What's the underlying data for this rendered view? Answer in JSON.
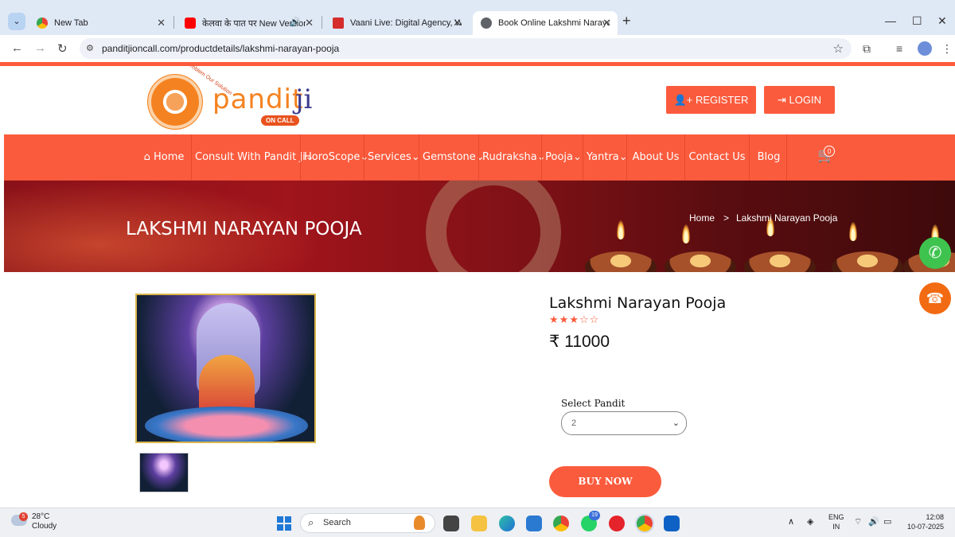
{
  "browser": {
    "tabs": [
      {
        "title": "New Tab"
      },
      {
        "title": "केलवा के पात पर New Version"
      },
      {
        "title": "Vaani Live: Digital Agency, Web"
      },
      {
        "title": "Book Online Lakshmi Narayan P"
      }
    ],
    "url": "panditjioncall.com/productdetails/lakshmi-narayan-pooja"
  },
  "site": {
    "logo": {
      "brand": "pandit",
      "brand_suffix": "ji",
      "oncall": "ON CALL",
      "tagline": "Your Problem Our Solution"
    },
    "register_label": "REGISTER",
    "login_label": "LOGIN",
    "nav": [
      {
        "label": "Home"
      },
      {
        "label": "Consult With Pandit Ji"
      },
      {
        "label": "HoroScope"
      },
      {
        "label": "Services"
      },
      {
        "label": "Gemstone"
      },
      {
        "label": "Rudraksha"
      },
      {
        "label": "Pooja"
      },
      {
        "label": "Yantra"
      },
      {
        "label": "About Us"
      },
      {
        "label": "Contact Us"
      },
      {
        "label": "Blog"
      }
    ],
    "cart_count": "0"
  },
  "hero": {
    "title": "LAKSHMI NARAYAN POOJA",
    "breadcrumb": {
      "home": "Home",
      "sep": ">",
      "current": "Lakshmi Narayan Pooja"
    }
  },
  "product": {
    "title": "Lakshmi Narayan Pooja",
    "rating": 3,
    "rating_max": 5,
    "price": "₹ 11000",
    "select_label": "Select Pandit",
    "select_value": "2",
    "buy_label": "BUY NOW"
  },
  "taskbar": {
    "weather_badge": "5",
    "temp": "28°C",
    "condition": "Cloudy",
    "search_label": "Search",
    "notif_badge": "19",
    "lang_top": "ENG",
    "lang_bottom": "IN",
    "time": "12:08",
    "date": "10-07-2025"
  }
}
